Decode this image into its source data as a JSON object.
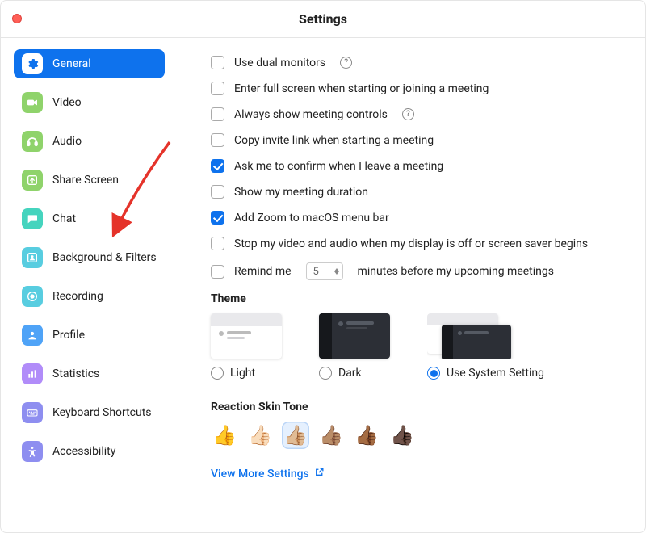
{
  "window": {
    "title": "Settings"
  },
  "sidebar": {
    "items": [
      {
        "id": "general",
        "label": "General",
        "color": "#0e72ed",
        "active": true
      },
      {
        "id": "video",
        "label": "Video",
        "color": "#8fd36b"
      },
      {
        "id": "audio",
        "label": "Audio",
        "color": "#8fd36b"
      },
      {
        "id": "share",
        "label": "Share Screen",
        "color": "#8fd36b"
      },
      {
        "id": "chat",
        "label": "Chat",
        "color": "#45d4be"
      },
      {
        "id": "bgfilters",
        "label": "Background & Filters",
        "color": "#58cde0"
      },
      {
        "id": "recording",
        "label": "Recording",
        "color": "#58cde0"
      },
      {
        "id": "profile",
        "label": "Profile",
        "color": "#4fa3f7"
      },
      {
        "id": "stats",
        "label": "Statistics",
        "color": "#b18cf9"
      },
      {
        "id": "keyboard",
        "label": "Keyboard Shortcuts",
        "color": "#8e8ef0"
      },
      {
        "id": "a11y",
        "label": "Accessibility",
        "color": "#8e8ef0"
      }
    ]
  },
  "general": {
    "options": [
      {
        "label": "Use dual monitors",
        "checked": false,
        "help": true
      },
      {
        "label": "Enter full screen when starting or joining a meeting",
        "checked": false
      },
      {
        "label": "Always show meeting controls",
        "checked": false,
        "help": true
      },
      {
        "label": "Copy invite link when starting a meeting",
        "checked": false
      },
      {
        "label": "Ask me to confirm when I leave a meeting",
        "checked": true
      },
      {
        "label": "Show my meeting duration",
        "checked": false
      },
      {
        "label": "Add Zoom to macOS menu bar",
        "checked": true
      },
      {
        "label": "Stop my video and audio when my display is off or screen saver begins",
        "checked": false
      }
    ],
    "remind": {
      "prefix": "Remind me",
      "value": "5",
      "suffix": "minutes before my upcoming meetings",
      "checked": false
    },
    "theme": {
      "heading": "Theme",
      "choices": [
        {
          "id": "light",
          "label": "Light",
          "selected": false
        },
        {
          "id": "dark",
          "label": "Dark",
          "selected": false
        },
        {
          "id": "system",
          "label": "Use System Setting",
          "selected": true
        }
      ]
    },
    "skin": {
      "heading": "Reaction Skin Tone",
      "tones": [
        "👍",
        "👍🏻",
        "👍🏼",
        "👍🏽",
        "👍🏾",
        "👍🏿"
      ],
      "selected_index": 2
    },
    "more_link": "View More Settings"
  }
}
